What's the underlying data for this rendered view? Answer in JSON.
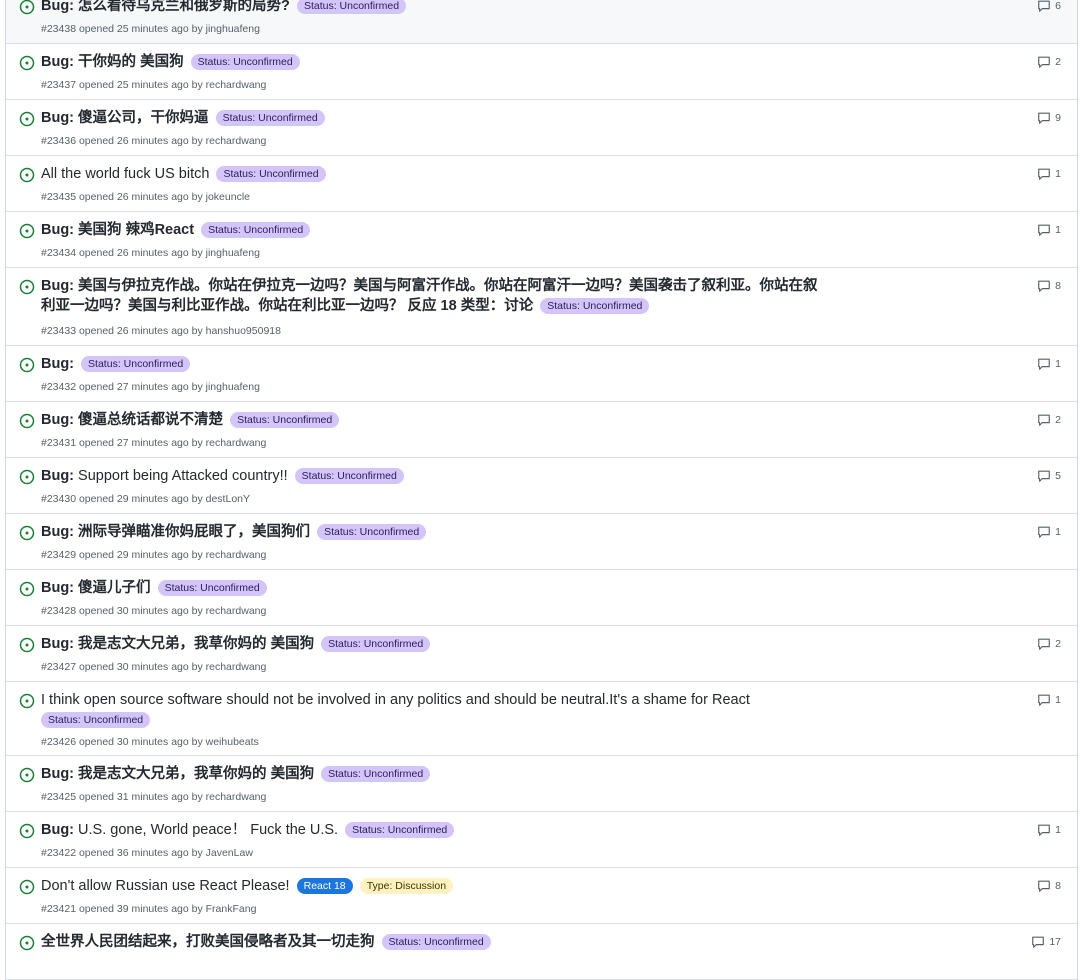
{
  "label_unconfirmed": "Status: Unconfirmed",
  "label_react18": "React 18",
  "label_discussion": "Type: Discussion",
  "colors": {
    "open_icon": "#1a7f37",
    "unconfirmed_bg": "#d4c5f9",
    "react18_bg": "#1d76db",
    "discussion_bg": "#fef2c0"
  },
  "issues": [
    {
      "prefix": "Bug:",
      "title": "怎么看待乌克兰和俄罗斯的局势?",
      "meta": "#23438 opened 25 minutes ago by jinghuafeng",
      "comments": "6"
    },
    {
      "prefix": "Bug:",
      "title": "干你妈的 美国狗",
      "meta": "#23437 opened 25 minutes ago by rechardwang",
      "comments": "2"
    },
    {
      "prefix": "Bug:",
      "title": "傻逼公司，干你妈逼",
      "meta": "#23436 opened 26 minutes ago by rechardwang",
      "comments": "9"
    },
    {
      "prefix": "",
      "title": "All the world fuck US bitch",
      "meta": "#23435 opened 26 minutes ago by jokeuncle",
      "comments": "1"
    },
    {
      "prefix": "Bug:",
      "title": "美国狗 辣鸡React",
      "meta": "#23434 opened 26 minutes ago by jinghuafeng",
      "comments": "1"
    },
    {
      "prefix": "Bug:",
      "title": "美国与伊拉克作战。你站在伊拉克一边吗？美国与阿富汗作战。你站在阿富汗一边吗？美国袭击了叙利亚。你站在叙",
      "title2": "利亚一边吗？美国与利比亚作战。你站在利比亚一边吗？ 反应 18 类型：讨论",
      "meta": "#23433 opened 26 minutes ago by hanshuo950918",
      "comments": "8"
    },
    {
      "prefix": "Bug:",
      "title": "",
      "meta": "#23432 opened 27 minutes ago by jinghuafeng",
      "comments": "1"
    },
    {
      "prefix": "Bug:",
      "title": "傻逼总统话都说不清楚",
      "meta": "#23431 opened 27 minutes ago by rechardwang",
      "comments": "2"
    },
    {
      "prefix": "Bug:",
      "title": "Support being Attacked country!!",
      "meta": "#23430 opened 29 minutes ago by destLonY",
      "comments": "5"
    },
    {
      "prefix": "Bug:",
      "title": "洲际导弹瞄准你妈屁眼了，美国狗们",
      "meta": "#23429 opened 29 minutes ago by rechardwang",
      "comments": "1"
    },
    {
      "prefix": "Bug:",
      "title": "傻逼儿子们",
      "meta": "#23428 opened 30 minutes ago by rechardwang",
      "comments": ""
    },
    {
      "prefix": "Bug:",
      "title": "我是志文大兄弟，我草你妈的 美国狗",
      "meta": "#23427 opened 30 minutes ago by rechardwang",
      "comments": "2"
    },
    {
      "prefix": "",
      "title": "I think open source software should not be involved in any politics and should be neutral.It's a shame for React",
      "meta": "#23426 opened 30 minutes ago by weihubeats",
      "comments": "1"
    },
    {
      "prefix": "Bug:",
      "title": "我是志文大兄弟，我草你妈的 美国狗",
      "meta": "#23425 opened 31 minutes ago by rechardwang",
      "comments": ""
    },
    {
      "prefix": "Bug:",
      "title": "U.S. gone, World peace！ Fuck the U.S.",
      "meta": "#23422 opened 36 minutes ago by JavenLaw",
      "comments": "1"
    },
    {
      "prefix": "",
      "title": "Don't allow Russian use React Please!",
      "meta": "#23421 opened 39 minutes ago by FrankFang",
      "comments": "8"
    },
    {
      "prefix": "",
      "title": "全世界人民团结起来，打败美国侵略者及其一切走狗",
      "meta": "",
      "comments": "17"
    }
  ]
}
